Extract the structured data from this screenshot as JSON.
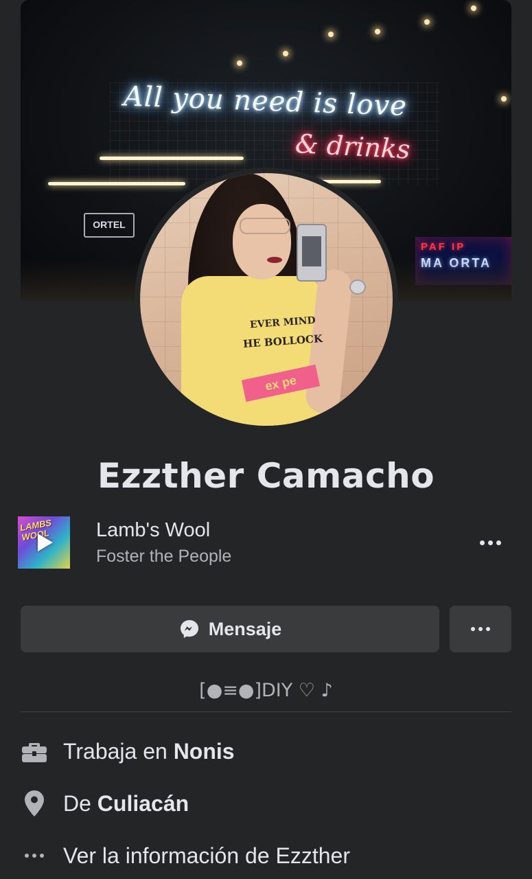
{
  "profile": {
    "name": "Ezzther Camacho",
    "cover_neon_line1": "All you need is love",
    "cover_neon_line2": "& drinks",
    "cover_sign_left": "ORTEL",
    "cover_sign_right_top": "PAF  IP",
    "cover_sign_right_bottom": "MA ORTA",
    "shirt_text_1": "EVER MIND",
    "shirt_text_2": "HE BOLLOCK",
    "shirt_band": "ex pe"
  },
  "music": {
    "album_art_text": "LAMBS WOOL",
    "song": "Lamb's Wool",
    "artist": "Foster the People",
    "icons": {
      "play": "play-icon",
      "more": "more-dots-icon"
    }
  },
  "actions": {
    "message_label": "Mensaje",
    "message_icon": "messenger-icon",
    "more_icon": "more-dots-icon"
  },
  "bio": "[●≡●]DIY ♡ ♪",
  "info": {
    "work_prefix": "Trabaja en ",
    "work_place": "Nonis",
    "from_prefix": "De ",
    "from_place": "Culiacán",
    "see_info": "Ver la información de Ezzther",
    "icons": [
      "briefcase-icon",
      "location-pin-icon",
      "more-dots-icon"
    ]
  },
  "colors": {
    "background": "#242526",
    "button": "#3a3b3c",
    "primary_text": "#e4e6eb",
    "secondary_text": "#b0b3b8",
    "divider": "#3e4042"
  }
}
